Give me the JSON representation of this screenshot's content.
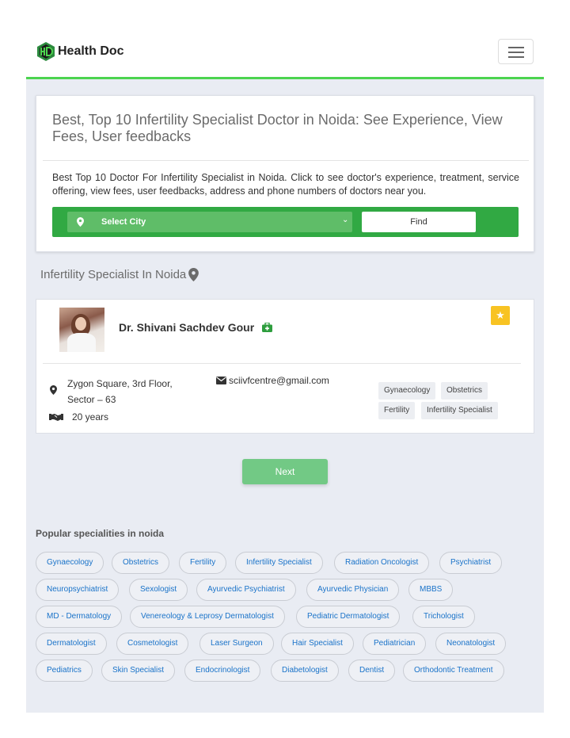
{
  "brand": {
    "name": "Health Doc",
    "logo_icon": "hd-logo-icon",
    "logo_colors": {
      "fill": "#2b8a3e",
      "text": "#1a1a1a"
    }
  },
  "navbar": {
    "menu_icon": "hamburger-menu-icon",
    "accent": "#4cd44f"
  },
  "intro": {
    "title": "Best, Top 10 Infertility Specialist Doctor in Noida: See Experience, View Fees, User feedbacks",
    "description": "Best Top 10 Doctor For Infertility Specialist in Noida. Click to see doctor's experience, treatment, service offering, view fees, user feedbacks, address and phone numbers of doctors near you."
  },
  "search": {
    "city_select": "Select City",
    "find_button": "Find",
    "bar_color": "#31a943"
  },
  "listing": {
    "heading": "Infertility Specialist In Noida"
  },
  "doctor": {
    "name": "Dr. Shivani Sachdev Gour",
    "address_line1": "Zygon Square, 3rd Floor,",
    "address_line2": "Sector – 63",
    "experience": "20 years",
    "email": "sciivfcentre@gmail.com",
    "tags": [
      "Gynaecology",
      "Obstetrics",
      "Fertility",
      "Infertility Specialist"
    ],
    "star_color": "#f8c323"
  },
  "pagination": {
    "next_label": "Next"
  },
  "popular": {
    "heading": "Popular specialities in noida",
    "chips": [
      "Gynaecology",
      "Obstetrics",
      "Fertility",
      "Infertility Specialist",
      "Radiation Oncologist",
      "Psychiatrist",
      "Neuropsychiatrist",
      "Sexologist",
      "Ayurvedic Psychiatrist",
      "Ayurvedic Physician",
      "MBBS",
      "MD - Dermatology",
      "Venereology & Leprosy Dermatologist",
      "Pediatric Dermatologist",
      "Trichologist",
      "Dermatologist",
      "Cosmetologist",
      "Laser Surgeon",
      "Hair Specialist",
      "Pediatrician",
      "Neonatologist",
      "Pediatrics",
      "Skin Specialist",
      "Endocrinologist",
      "Diabetologist",
      "Dentist",
      "Orthodontic Treatment"
    ]
  }
}
